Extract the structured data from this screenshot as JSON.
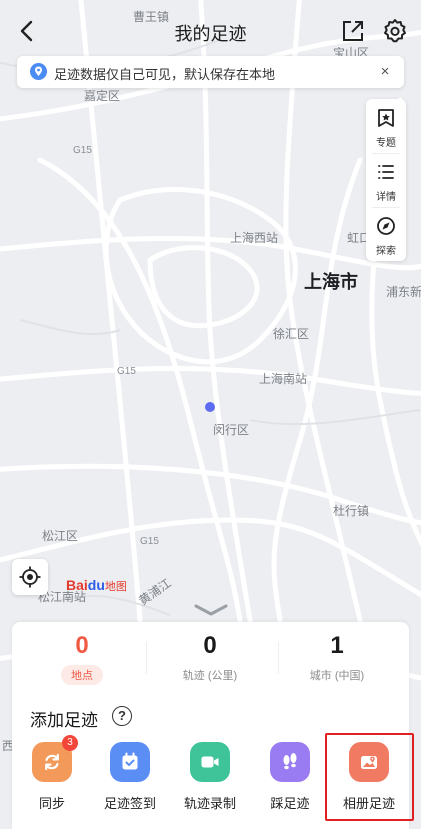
{
  "header": {
    "title": "我的足迹"
  },
  "notice": {
    "text": "足迹数据仅自己可见，默认保存在本地",
    "close": "×"
  },
  "toolbar": {
    "items": [
      {
        "label": "专题",
        "icon": "topic-icon"
      },
      {
        "label": "详情",
        "icon": "list-icon"
      },
      {
        "label": "探索",
        "icon": "explore-icon"
      }
    ]
  },
  "map": {
    "labels": {
      "caowang": "曹王镇",
      "baoshan": "宝山区",
      "jiading": "嘉定区",
      "g15_a": "G15",
      "g15_b": "G15",
      "g15_c": "G15",
      "shanghai_west": "上海西站",
      "hongkou": "虹口",
      "shanghai": "上海市",
      "pudong": "浦东新",
      "xuhui": "徐汇区",
      "shanghai_south": "上海南站",
      "minhang": "闵行区",
      "songjiang": "松江区",
      "songjiang_south": "松江南站",
      "huangpu": "黄浦江",
      "duhang": "杜行镇",
      "west_edge": "西"
    },
    "logo": {
      "brand_a": "Bai",
      "brand_b": "du",
      "brand_c": "地图"
    }
  },
  "stats": [
    {
      "value": "0",
      "label": "地点"
    },
    {
      "value": "0",
      "label": "轨迹 (公里)"
    },
    {
      "value": "1",
      "label": "城市 (中国)"
    }
  ],
  "add": {
    "title": "添加足迹",
    "help": "?",
    "actions": [
      {
        "label": "同步",
        "color": "#f39a5a",
        "badge": "3"
      },
      {
        "label": "足迹签到",
        "color": "#5b8ef5"
      },
      {
        "label": "轨迹录制",
        "color": "#3fc49a"
      },
      {
        "label": "踩足迹",
        "color": "#9a7cf2"
      },
      {
        "label": "相册足迹",
        "color": "#f07a62"
      }
    ]
  },
  "colors": {
    "accent_red": "#f05a45",
    "location_dot": "#5b6cf0"
  }
}
